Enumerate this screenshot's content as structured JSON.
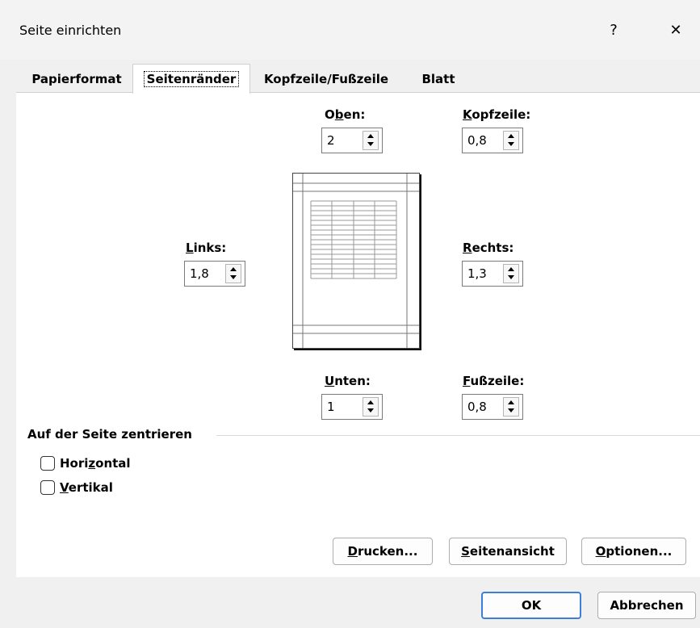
{
  "window": {
    "title": "Seite einrichten",
    "help_label": "?",
    "close_label": "✕"
  },
  "tabs": [
    {
      "label": "Papierformat"
    },
    {
      "label": "Seitenränder"
    },
    {
      "label": "Kopfzeile/Fußzeile"
    },
    {
      "label": "Blatt"
    }
  ],
  "margins": {
    "top": {
      "label_pre": "O",
      "label_u": "b",
      "label_post": "en:",
      "value": "2"
    },
    "header": {
      "label_pre": "",
      "label_u": "K",
      "label_post": "opfzeile:",
      "value": "0,8"
    },
    "left": {
      "label_pre": "",
      "label_u": "L",
      "label_post": "inks:",
      "value": "1,8"
    },
    "right": {
      "label_pre": "",
      "label_u": "R",
      "label_post": "echts:",
      "value": "1,3"
    },
    "bottom": {
      "label_pre": "",
      "label_u": "U",
      "label_post": "nten:",
      "value": "1"
    },
    "footer": {
      "label_pre": "",
      "label_u": "F",
      "label_post": "ußzeile:",
      "value": "0,8"
    }
  },
  "center": {
    "group_label": "Auf der Seite zentrieren",
    "horizontal": {
      "pre": "Hori",
      "u": "z",
      "post": "ontal",
      "checked": false
    },
    "vertical": {
      "pre": "",
      "u": "V",
      "post": "ertikal",
      "checked": false
    }
  },
  "buttons": {
    "print": {
      "pre": "",
      "u": "D",
      "post": "rucken..."
    },
    "preview": {
      "pre": "",
      "u": "S",
      "post": "eitenansicht"
    },
    "options": {
      "pre": "",
      "u": "O",
      "post": "ptionen..."
    },
    "ok": "OK",
    "cancel": "Abbrechen"
  }
}
